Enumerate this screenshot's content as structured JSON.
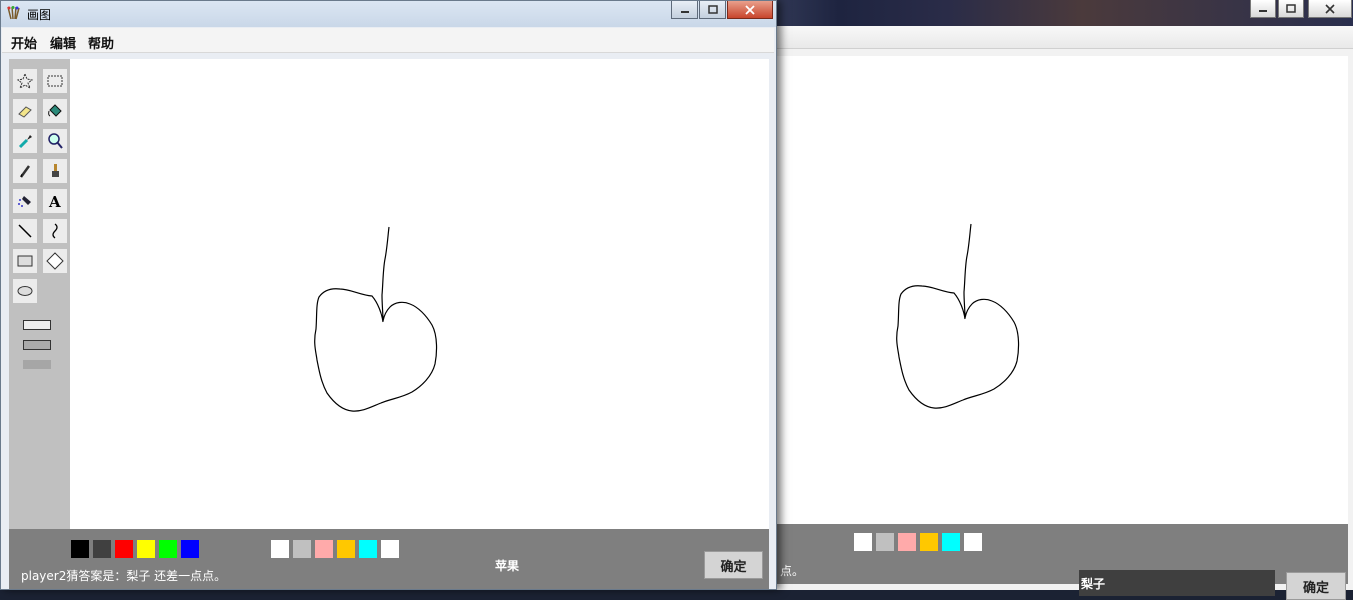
{
  "window_left": {
    "title": "画图",
    "menu": [
      "开始",
      "编辑",
      "帮助"
    ],
    "tools": [
      "free-select-icon",
      "rect-select-icon",
      "eraser-icon",
      "fill-bucket-icon",
      "color-picker-icon",
      "magnifier-icon",
      "pencil-icon",
      "brush-icon",
      "airbrush-icon",
      "text-icon",
      "line-icon",
      "curve-icon",
      "rectangle-icon",
      "polygon-icon",
      "ellipse-icon"
    ],
    "palette_primary": [
      "#000000",
      "#404040",
      "#ff0000",
      "#ffff00",
      "#00ff00",
      "#0000ff"
    ],
    "palette_secondary": [
      "#ffffff",
      "#c0c0c0",
      "#ffaaaa",
      "#ffc800",
      "#00ffff",
      "#ffffff"
    ],
    "word": "苹果",
    "status": "player2猜答案是：梨子 还差一点点。",
    "confirm": "确定"
  },
  "window_right": {
    "palette": [
      "#ffffff",
      "#c0c0c0",
      "#ffaaaa",
      "#ffc800",
      "#00ffff",
      "#ffffff"
    ],
    "status_tail": "点。",
    "guess_value": "梨子",
    "confirm": "确定"
  },
  "colors": {
    "accent_close": "#c8452c",
    "panel_gray": "#7f7f7f"
  }
}
